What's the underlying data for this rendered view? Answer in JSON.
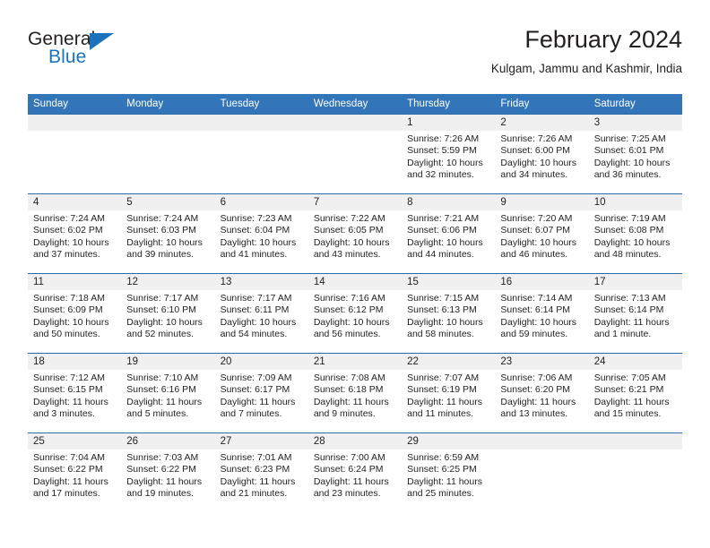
{
  "brand": {
    "word_one": "General",
    "word_two": "Blue",
    "triangle_icon": "triangle-icon",
    "accent_color": "#1b74bb"
  },
  "header": {
    "title": "February 2024",
    "location": "Kulgam, Jammu and Kashmir, India"
  },
  "theme": {
    "header_bar": "#3275b8",
    "row_rule": "#2b6ca8",
    "daynum_band": "#f0f0f0",
    "text": "#231f20"
  },
  "weekday_headers": [
    "Sunday",
    "Monday",
    "Tuesday",
    "Wednesday",
    "Thursday",
    "Friday",
    "Saturday"
  ],
  "chart_data": {
    "type": "table",
    "title": "February 2024",
    "subtitle": "Kulgam, Jammu and Kashmir, India",
    "columns": [
      "Sunday",
      "Monday",
      "Tuesday",
      "Wednesday",
      "Thursday",
      "Friday",
      "Saturday"
    ],
    "weeks": [
      [
        {
          "day": "",
          "lines": []
        },
        {
          "day": "",
          "lines": []
        },
        {
          "day": "",
          "lines": []
        },
        {
          "day": "",
          "lines": []
        },
        {
          "day": "1",
          "lines": [
            "Sunrise: 7:26 AM",
            "Sunset: 5:59 PM",
            "Daylight: 10 hours",
            "and 32 minutes."
          ]
        },
        {
          "day": "2",
          "lines": [
            "Sunrise: 7:26 AM",
            "Sunset: 6:00 PM",
            "Daylight: 10 hours",
            "and 34 minutes."
          ]
        },
        {
          "day": "3",
          "lines": [
            "Sunrise: 7:25 AM",
            "Sunset: 6:01 PM",
            "Daylight: 10 hours",
            "and 36 minutes."
          ]
        }
      ],
      [
        {
          "day": "4",
          "lines": [
            "Sunrise: 7:24 AM",
            "Sunset: 6:02 PM",
            "Daylight: 10 hours",
            "and 37 minutes."
          ]
        },
        {
          "day": "5",
          "lines": [
            "Sunrise: 7:24 AM",
            "Sunset: 6:03 PM",
            "Daylight: 10 hours",
            "and 39 minutes."
          ]
        },
        {
          "day": "6",
          "lines": [
            "Sunrise: 7:23 AM",
            "Sunset: 6:04 PM",
            "Daylight: 10 hours",
            "and 41 minutes."
          ]
        },
        {
          "day": "7",
          "lines": [
            "Sunrise: 7:22 AM",
            "Sunset: 6:05 PM",
            "Daylight: 10 hours",
            "and 43 minutes."
          ]
        },
        {
          "day": "8",
          "lines": [
            "Sunrise: 7:21 AM",
            "Sunset: 6:06 PM",
            "Daylight: 10 hours",
            "and 44 minutes."
          ]
        },
        {
          "day": "9",
          "lines": [
            "Sunrise: 7:20 AM",
            "Sunset: 6:07 PM",
            "Daylight: 10 hours",
            "and 46 minutes."
          ]
        },
        {
          "day": "10",
          "lines": [
            "Sunrise: 7:19 AM",
            "Sunset: 6:08 PM",
            "Daylight: 10 hours",
            "and 48 minutes."
          ]
        }
      ],
      [
        {
          "day": "11",
          "lines": [
            "Sunrise: 7:18 AM",
            "Sunset: 6:09 PM",
            "Daylight: 10 hours",
            "and 50 minutes."
          ]
        },
        {
          "day": "12",
          "lines": [
            "Sunrise: 7:17 AM",
            "Sunset: 6:10 PM",
            "Daylight: 10 hours",
            "and 52 minutes."
          ]
        },
        {
          "day": "13",
          "lines": [
            "Sunrise: 7:17 AM",
            "Sunset: 6:11 PM",
            "Daylight: 10 hours",
            "and 54 minutes."
          ]
        },
        {
          "day": "14",
          "lines": [
            "Sunrise: 7:16 AM",
            "Sunset: 6:12 PM",
            "Daylight: 10 hours",
            "and 56 minutes."
          ]
        },
        {
          "day": "15",
          "lines": [
            "Sunrise: 7:15 AM",
            "Sunset: 6:13 PM",
            "Daylight: 10 hours",
            "and 58 minutes."
          ]
        },
        {
          "day": "16",
          "lines": [
            "Sunrise: 7:14 AM",
            "Sunset: 6:14 PM",
            "Daylight: 10 hours",
            "and 59 minutes."
          ]
        },
        {
          "day": "17",
          "lines": [
            "Sunrise: 7:13 AM",
            "Sunset: 6:14 PM",
            "Daylight: 11 hours",
            "and 1 minute."
          ]
        }
      ],
      [
        {
          "day": "18",
          "lines": [
            "Sunrise: 7:12 AM",
            "Sunset: 6:15 PM",
            "Daylight: 11 hours",
            "and 3 minutes."
          ]
        },
        {
          "day": "19",
          "lines": [
            "Sunrise: 7:10 AM",
            "Sunset: 6:16 PM",
            "Daylight: 11 hours",
            "and 5 minutes."
          ]
        },
        {
          "day": "20",
          "lines": [
            "Sunrise: 7:09 AM",
            "Sunset: 6:17 PM",
            "Daylight: 11 hours",
            "and 7 minutes."
          ]
        },
        {
          "day": "21",
          "lines": [
            "Sunrise: 7:08 AM",
            "Sunset: 6:18 PM",
            "Daylight: 11 hours",
            "and 9 minutes."
          ]
        },
        {
          "day": "22",
          "lines": [
            "Sunrise: 7:07 AM",
            "Sunset: 6:19 PM",
            "Daylight: 11 hours",
            "and 11 minutes."
          ]
        },
        {
          "day": "23",
          "lines": [
            "Sunrise: 7:06 AM",
            "Sunset: 6:20 PM",
            "Daylight: 11 hours",
            "and 13 minutes."
          ]
        },
        {
          "day": "24",
          "lines": [
            "Sunrise: 7:05 AM",
            "Sunset: 6:21 PM",
            "Daylight: 11 hours",
            "and 15 minutes."
          ]
        }
      ],
      [
        {
          "day": "25",
          "lines": [
            "Sunrise: 7:04 AM",
            "Sunset: 6:22 PM",
            "Daylight: 11 hours",
            "and 17 minutes."
          ]
        },
        {
          "day": "26",
          "lines": [
            "Sunrise: 7:03 AM",
            "Sunset: 6:22 PM",
            "Daylight: 11 hours",
            "and 19 minutes."
          ]
        },
        {
          "day": "27",
          "lines": [
            "Sunrise: 7:01 AM",
            "Sunset: 6:23 PM",
            "Daylight: 11 hours",
            "and 21 minutes."
          ]
        },
        {
          "day": "28",
          "lines": [
            "Sunrise: 7:00 AM",
            "Sunset: 6:24 PM",
            "Daylight: 11 hours",
            "and 23 minutes."
          ]
        },
        {
          "day": "29",
          "lines": [
            "Sunrise: 6:59 AM",
            "Sunset: 6:25 PM",
            "Daylight: 11 hours",
            "and 25 minutes."
          ]
        },
        {
          "day": "",
          "lines": []
        },
        {
          "day": "",
          "lines": []
        }
      ]
    ]
  }
}
